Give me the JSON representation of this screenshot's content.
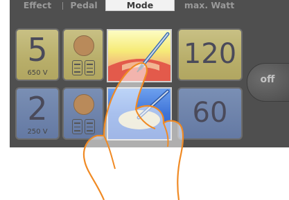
{
  "headers": {
    "effect": "Effect",
    "pedal": "Pedal",
    "mode": "Mode",
    "max_watt": "max. Watt"
  },
  "rows": [
    {
      "effect_value": "5",
      "effect_voltage": "650 V",
      "watt": "120"
    },
    {
      "effect_value": "2",
      "effect_voltage": "250 V",
      "watt": "60"
    }
  ],
  "off_button": "off",
  "icons": {
    "pedal": "pedal-icon",
    "mode_cut": "scalpel-cut-icon",
    "mode_coag": "scalpel-coag-icon",
    "hand": "pointing-hand-icon"
  },
  "colors": {
    "panel": "#4f4f4f",
    "yellow_tile": "#b8ae6a",
    "blue_tile": "#6479a3",
    "hand_outline": "#f08a24"
  }
}
